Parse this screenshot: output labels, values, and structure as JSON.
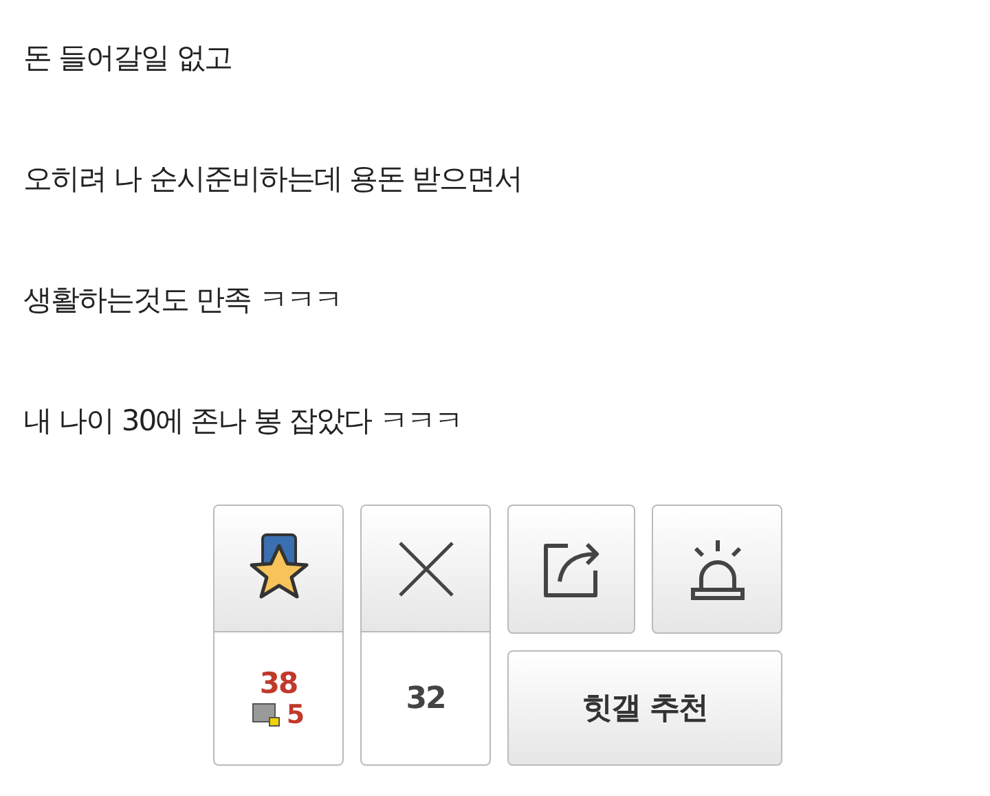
{
  "post_lines": [
    "돈 들어갈일 없고",
    "오히려 나 순시준비하는데 용돈 받으면서",
    "생활하는것도 만족 ㅋㅋㅋ",
    "내 나이 30에 존나 봉 잡았다 ㅋㅋㅋ"
  ],
  "vote": {
    "up_count": "38",
    "fixed_up_count": "5",
    "down_count": "32",
    "recommend_label": "힛갤 추천"
  }
}
